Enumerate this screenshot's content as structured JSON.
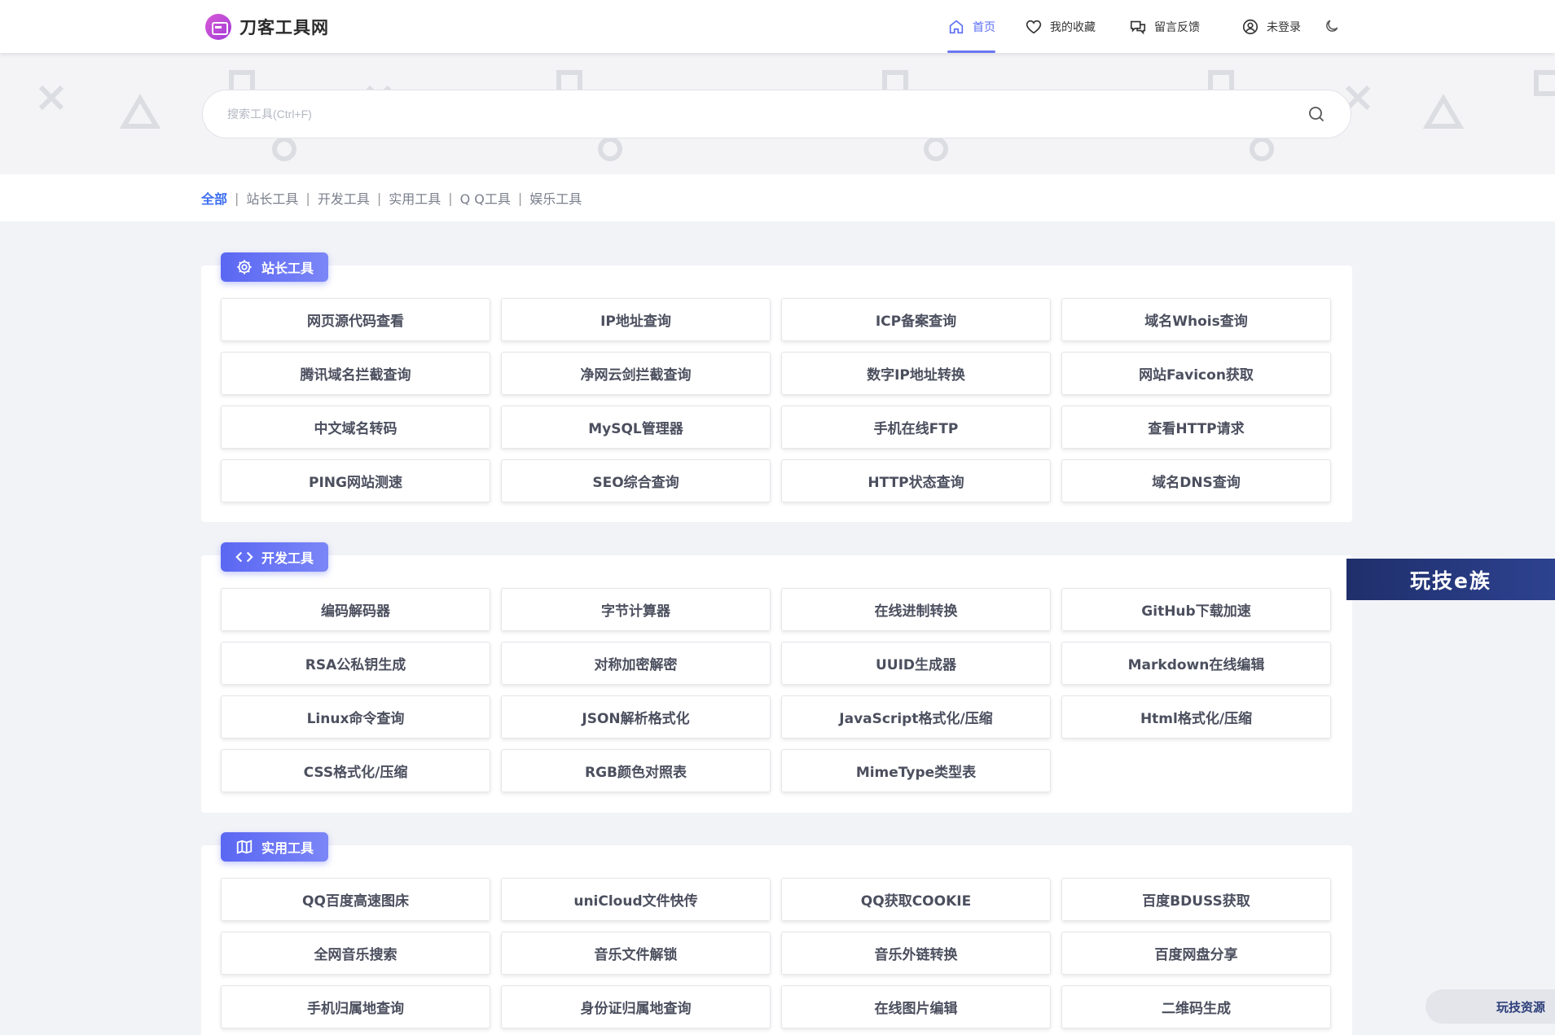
{
  "header": {
    "logo_text": "刀客工具网",
    "nav": [
      {
        "label": "首页",
        "icon": "home-icon",
        "active": true
      },
      {
        "label": "我的收藏",
        "icon": "heart-icon"
      },
      {
        "label": "留言反馈",
        "icon": "chat-icon"
      },
      {
        "label": "未登录",
        "icon": "user-icon"
      }
    ],
    "theme_icon": "moon-icon",
    "accent": "#5b6ef5"
  },
  "search": {
    "placeholder": "搜索工具(Ctrl+F)"
  },
  "categories": [
    "全部",
    "站长工具",
    "开发工具",
    "实用工具",
    "Q Q工具",
    "娱乐工具"
  ],
  "sections": [
    {
      "title": "站长工具",
      "icon": "gear-icon",
      "tools": [
        "网页源代码查看",
        "IP地址查询",
        "ICP备案查询",
        "域名Whois查询",
        "腾讯域名拦截查询",
        "净网云剑拦截查询",
        "数字IP地址转换",
        "网站Favicon获取",
        "中文域名转码",
        "MySQL管理器",
        "手机在线FTP",
        "查看HTTP请求",
        "PING网站测速",
        "SEO综合查询",
        "HTTP状态查询",
        "域名DNS查询"
      ]
    },
    {
      "title": "开发工具",
      "icon": "code-icon",
      "tools": [
        "编码解码器",
        "字节计算器",
        "在线进制转换",
        "GitHub下载加速",
        "RSA公私钥生成",
        "对称加密解密",
        "UUID生成器",
        "Markdown在线编辑",
        "Linux命令查询",
        "JSON解析格式化",
        "JavaScript格式化/压缩",
        "Html格式化/压缩",
        "CSS格式化/压缩",
        "RGB颜色对照表",
        "MimeType类型表"
      ]
    },
    {
      "title": "实用工具",
      "icon": "map-icon",
      "tools": [
        "QQ百度高速图床",
        "uniCloud文件快传",
        "QQ获取COOKIE",
        "百度BDUSS获取",
        "全网音乐搜索",
        "音乐文件解锁",
        "音乐外链转换",
        "百度网盘分享",
        "手机归属地查询",
        "身份证归属地查询",
        "在线图片编辑",
        "二维码生成"
      ]
    }
  ],
  "side_banner": {
    "text": "玩技e族"
  },
  "corner_badge": {
    "text": "玩技资源"
  }
}
